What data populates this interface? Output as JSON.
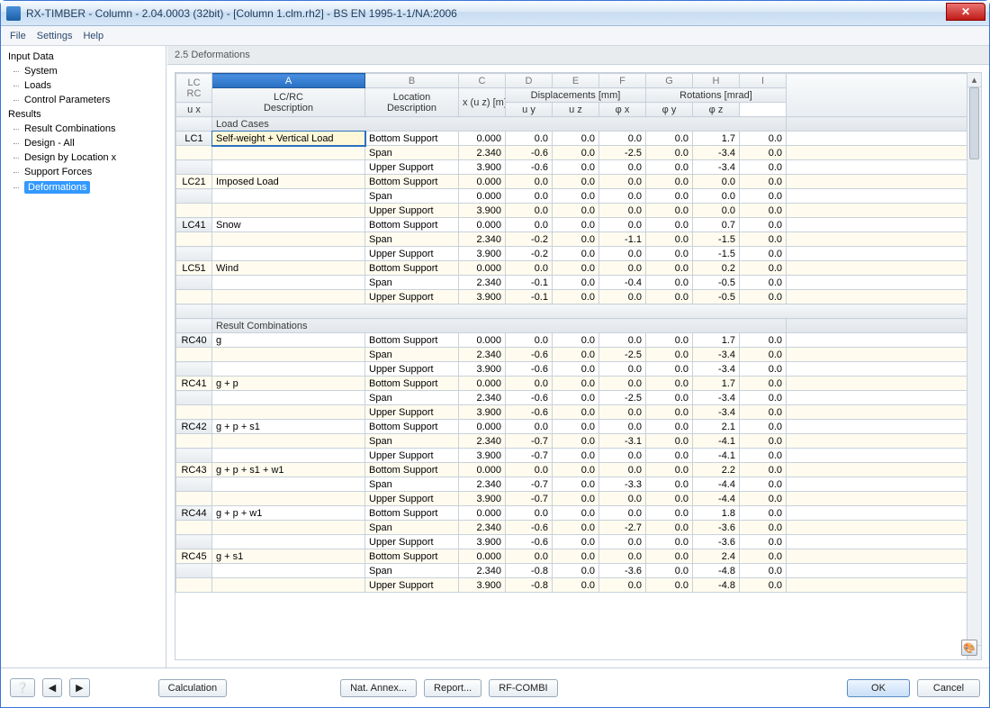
{
  "window": {
    "title": "RX-TIMBER - Column - 2.04.0003 (32bit) - [Column 1.clm.rh2] - BS EN 1995-1-1/NA:2006"
  },
  "menu": {
    "file": "File",
    "settings": "Settings",
    "help": "Help"
  },
  "nav": {
    "input_data": "Input Data",
    "system": "System",
    "loads": "Loads",
    "control_parameters": "Control Parameters",
    "results": "Results",
    "result_combinations": "Result Combinations",
    "design_all": "Design - All",
    "design_by_location_x": "Design by Location x",
    "support_forces": "Support Forces",
    "deformations": "Deformations"
  },
  "panel": {
    "title": "2.5 Deformations"
  },
  "columns": {
    "letters": [
      "A",
      "B",
      "C",
      "D",
      "E",
      "F",
      "G",
      "H",
      "I"
    ],
    "lc_rc_h": "LC\nRC",
    "lc_rc_desc": "LC/RC\nDescription",
    "location_desc": "Location\nDescription",
    "x_uz": "x (u z) [m]",
    "disp_group": "Displacements [mm]",
    "ux": "u x",
    "uy": "u y",
    "uz": "u z",
    "rot_group": "Rotations [mrad]",
    "phx": "φ x",
    "phy": "φ y",
    "phz": "φ z"
  },
  "sections": {
    "load_cases": "Load Cases",
    "result_combinations": "Result Combinations"
  },
  "rows": [
    {
      "lc": "LC1",
      "desc": "Self-weight + Vertical Load",
      "loc": "Bottom Support",
      "x": "0.000",
      "ux": "0.0",
      "uy": "0.0",
      "uz": "0.0",
      "phx": "0.0",
      "phy": "1.7",
      "phz": "0.0",
      "first": true
    },
    {
      "lc": "",
      "desc": "",
      "loc": "Span",
      "x": "2.340",
      "ux": "-0.6",
      "uy": "0.0",
      "uz": "-2.5",
      "phx": "0.0",
      "phy": "-3.4",
      "phz": "0.0",
      "alt": true
    },
    {
      "lc": "",
      "desc": "",
      "loc": "Upper Support",
      "x": "3.900",
      "ux": "-0.6",
      "uy": "0.0",
      "uz": "0.0",
      "phx": "0.0",
      "phy": "-3.4",
      "phz": "0.0"
    },
    {
      "lc": "LC21",
      "desc": "Imposed Load",
      "loc": "Bottom Support",
      "x": "0.000",
      "ux": "0.0",
      "uy": "0.0",
      "uz": "0.0",
      "phx": "0.0",
      "phy": "0.0",
      "phz": "0.0",
      "alt": true
    },
    {
      "lc": "",
      "desc": "",
      "loc": "Span",
      "x": "0.000",
      "ux": "0.0",
      "uy": "0.0",
      "uz": "0.0",
      "phx": "0.0",
      "phy": "0.0",
      "phz": "0.0"
    },
    {
      "lc": "",
      "desc": "",
      "loc": "Upper Support",
      "x": "3.900",
      "ux": "0.0",
      "uy": "0.0",
      "uz": "0.0",
      "phx": "0.0",
      "phy": "0.0",
      "phz": "0.0",
      "alt": true
    },
    {
      "lc": "LC41",
      "desc": "Snow",
      "loc": "Bottom Support",
      "x": "0.000",
      "ux": "0.0",
      "uy": "0.0",
      "uz": "0.0",
      "phx": "0.0",
      "phy": "0.7",
      "phz": "0.0"
    },
    {
      "lc": "",
      "desc": "",
      "loc": "Span",
      "x": "2.340",
      "ux": "-0.2",
      "uy": "0.0",
      "uz": "-1.1",
      "phx": "0.0",
      "phy": "-1.5",
      "phz": "0.0",
      "alt": true
    },
    {
      "lc": "",
      "desc": "",
      "loc": "Upper Support",
      "x": "3.900",
      "ux": "-0.2",
      "uy": "0.0",
      "uz": "0.0",
      "phx": "0.0",
      "phy": "-1.5",
      "phz": "0.0"
    },
    {
      "lc": "LC51",
      "desc": "Wind",
      "loc": "Bottom Support",
      "x": "0.000",
      "ux": "0.0",
      "uy": "0.0",
      "uz": "0.0",
      "phx": "0.0",
      "phy": "0.2",
      "phz": "0.0",
      "alt": true
    },
    {
      "lc": "",
      "desc": "",
      "loc": "Span",
      "x": "2.340",
      "ux": "-0.1",
      "uy": "0.0",
      "uz": "-0.4",
      "phx": "0.0",
      "phy": "-0.5",
      "phz": "0.0"
    },
    {
      "lc": "",
      "desc": "",
      "loc": "Upper Support",
      "x": "3.900",
      "ux": "-0.1",
      "uy": "0.0",
      "uz": "0.0",
      "phx": "0.0",
      "phy": "-0.5",
      "phz": "0.0",
      "alt": true
    }
  ],
  "rows_rc": [
    {
      "lc": "RC40",
      "desc": "g",
      "loc": "Bottom Support",
      "x": "0.000",
      "ux": "0.0",
      "uy": "0.0",
      "uz": "0.0",
      "phx": "0.0",
      "phy": "1.7",
      "phz": "0.0"
    },
    {
      "lc": "",
      "desc": "",
      "loc": "Span",
      "x": "2.340",
      "ux": "-0.6",
      "uy": "0.0",
      "uz": "-2.5",
      "phx": "0.0",
      "phy": "-3.4",
      "phz": "0.0",
      "alt": true
    },
    {
      "lc": "",
      "desc": "",
      "loc": "Upper Support",
      "x": "3.900",
      "ux": "-0.6",
      "uy": "0.0",
      "uz": "0.0",
      "phx": "0.0",
      "phy": "-3.4",
      "phz": "0.0"
    },
    {
      "lc": "RC41",
      "desc": "g + p",
      "loc": "Bottom Support",
      "x": "0.000",
      "ux": "0.0",
      "uy": "0.0",
      "uz": "0.0",
      "phx": "0.0",
      "phy": "1.7",
      "phz": "0.0",
      "alt": true
    },
    {
      "lc": "",
      "desc": "",
      "loc": "Span",
      "x": "2.340",
      "ux": "-0.6",
      "uy": "0.0",
      "uz": "-2.5",
      "phx": "0.0",
      "phy": "-3.4",
      "phz": "0.0"
    },
    {
      "lc": "",
      "desc": "",
      "loc": "Upper Support",
      "x": "3.900",
      "ux": "-0.6",
      "uy": "0.0",
      "uz": "0.0",
      "phx": "0.0",
      "phy": "-3.4",
      "phz": "0.0",
      "alt": true
    },
    {
      "lc": "RC42",
      "desc": "g + p + s1",
      "loc": "Bottom Support",
      "x": "0.000",
      "ux": "0.0",
      "uy": "0.0",
      "uz": "0.0",
      "phx": "0.0",
      "phy": "2.1",
      "phz": "0.0"
    },
    {
      "lc": "",
      "desc": "",
      "loc": "Span",
      "x": "2.340",
      "ux": "-0.7",
      "uy": "0.0",
      "uz": "-3.1",
      "phx": "0.0",
      "phy": "-4.1",
      "phz": "0.0",
      "alt": true
    },
    {
      "lc": "",
      "desc": "",
      "loc": "Upper Support",
      "x": "3.900",
      "ux": "-0.7",
      "uy": "0.0",
      "uz": "0.0",
      "phx": "0.0",
      "phy": "-4.1",
      "phz": "0.0"
    },
    {
      "lc": "RC43",
      "desc": "g + p + s1 + w1",
      "loc": "Bottom Support",
      "x": "0.000",
      "ux": "0.0",
      "uy": "0.0",
      "uz": "0.0",
      "phx": "0.0",
      "phy": "2.2",
      "phz": "0.0",
      "alt": true
    },
    {
      "lc": "",
      "desc": "",
      "loc": "Span",
      "x": "2.340",
      "ux": "-0.7",
      "uy": "0.0",
      "uz": "-3.3",
      "phx": "0.0",
      "phy": "-4.4",
      "phz": "0.0"
    },
    {
      "lc": "",
      "desc": "",
      "loc": "Upper Support",
      "x": "3.900",
      "ux": "-0.7",
      "uy": "0.0",
      "uz": "0.0",
      "phx": "0.0",
      "phy": "-4.4",
      "phz": "0.0",
      "alt": true
    },
    {
      "lc": "RC44",
      "desc": "g + p + w1",
      "loc": "Bottom Support",
      "x": "0.000",
      "ux": "0.0",
      "uy": "0.0",
      "uz": "0.0",
      "phx": "0.0",
      "phy": "1.8",
      "phz": "0.0"
    },
    {
      "lc": "",
      "desc": "",
      "loc": "Span",
      "x": "2.340",
      "ux": "-0.6",
      "uy": "0.0",
      "uz": "-2.7",
      "phx": "0.0",
      "phy": "-3.6",
      "phz": "0.0",
      "alt": true
    },
    {
      "lc": "",
      "desc": "",
      "loc": "Upper Support",
      "x": "3.900",
      "ux": "-0.6",
      "uy": "0.0",
      "uz": "0.0",
      "phx": "0.0",
      "phy": "-3.6",
      "phz": "0.0"
    },
    {
      "lc": "RC45",
      "desc": "g + s1",
      "loc": "Bottom Support",
      "x": "0.000",
      "ux": "0.0",
      "uy": "0.0",
      "uz": "0.0",
      "phx": "0.0",
      "phy": "2.4",
      "phz": "0.0",
      "alt": true
    },
    {
      "lc": "",
      "desc": "",
      "loc": "Span",
      "x": "2.340",
      "ux": "-0.8",
      "uy": "0.0",
      "uz": "-3.6",
      "phx": "0.0",
      "phy": "-4.8",
      "phz": "0.0"
    },
    {
      "lc": "",
      "desc": "",
      "loc": "Upper Support",
      "x": "3.900",
      "ux": "-0.8",
      "uy": "0.0",
      "uz": "0.0",
      "phx": "0.0",
      "phy": "-4.8",
      "phz": "0.0",
      "alt": true
    }
  ],
  "footer": {
    "calculation": "Calculation",
    "nat_annex": "Nat. Annex...",
    "report": "Report...",
    "rf_combi": "RF-COMBI",
    "ok": "OK",
    "cancel": "Cancel"
  }
}
